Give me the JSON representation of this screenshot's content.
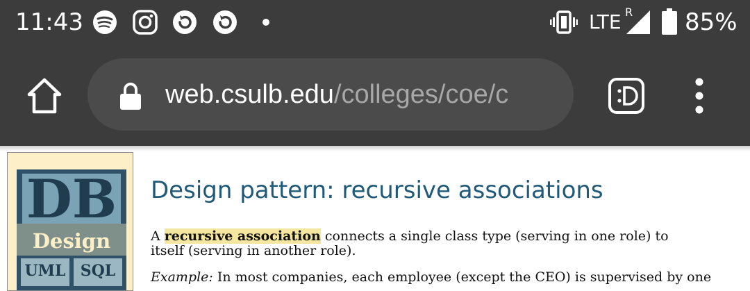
{
  "status_bar": {
    "time": "11:43",
    "network": "LTE",
    "roaming_marker": "R",
    "battery": "85%",
    "notification_icons": [
      "spotify-icon",
      "instagram-icon",
      "sync-icon",
      "sync-icon",
      "dot-icon"
    ],
    "system_icons": [
      "vibrate-icon",
      "signal-icon",
      "battery-icon"
    ]
  },
  "toolbar": {
    "url_domain": "web.csulb.edu",
    "url_path": "/colleges/coe/c",
    "icons": [
      "home-icon",
      "lock-icon",
      "extension-icon",
      "more-vert-icon"
    ]
  },
  "page": {
    "logo": {
      "line1": "DB",
      "line2": "Design",
      "line3a": "UML",
      "line3b": "SQL"
    },
    "title": "Design pattern: recursive associations",
    "para1": {
      "prefix": "A ",
      "highlight": "recursive association",
      "rest": " connects a single class type (serving in one role) to itself (serving in another role)."
    },
    "para2": {
      "label": "Example:",
      "rest": " In most companies, each employee (except the CEO) is supervised by one"
    }
  },
  "colors": {
    "bar_bg": "#3c3c3c",
    "omnibox_bg": "#4b4b4b",
    "title": "#205a78",
    "highlight": "#f5e6a0"
  }
}
